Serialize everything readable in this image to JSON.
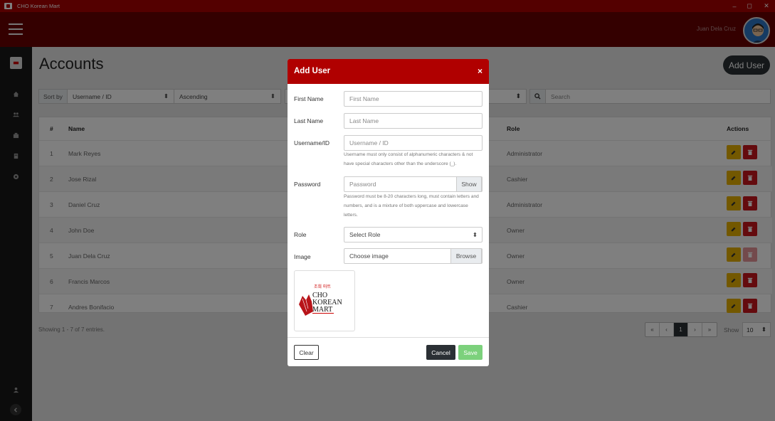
{
  "window": {
    "title": "CHO Korean Mart",
    "minimize": "–",
    "maximize": "◻",
    "close": "✕"
  },
  "topbar": {
    "user_name": "Juan Dela Cruz"
  },
  "page": {
    "title": "Accounts",
    "add_button": "Add User"
  },
  "toolbar": {
    "sort_label": "Sort by",
    "sort_value": "Username / ID",
    "order_value": "Ascending",
    "search_placeholder": "Search"
  },
  "table": {
    "headers": {
      "num": "#",
      "name": "Name",
      "role": "Role",
      "actions": "Actions"
    },
    "rows": [
      {
        "num": "1",
        "name": "Mark Reyes",
        "role": "Administrator"
      },
      {
        "num": "2",
        "name": "Jose Rizal",
        "role": "Cashier"
      },
      {
        "num": "3",
        "name": "Daniel Cruz",
        "role": "Administrator"
      },
      {
        "num": "4",
        "name": "John Doe",
        "role": "Owner"
      },
      {
        "num": "5",
        "name": "Juan Dela Cruz",
        "role": "Owner",
        "delete_disabled": true
      },
      {
        "num": "6",
        "name": "Francis Marcos",
        "role": "Owner"
      },
      {
        "num": "7",
        "name": "Andres Bonifacio",
        "role": "Cashier"
      }
    ]
  },
  "footer": {
    "entries": "Showing 1 - 7 of 7 entries.",
    "pager": [
      "«",
      "‹",
      "1",
      "›",
      "»"
    ],
    "active_page": "1",
    "show_label": "Show",
    "show_value": "10"
  },
  "modal": {
    "title": "Add User",
    "close": "×",
    "first_name": {
      "label": "First Name",
      "placeholder": "First Name"
    },
    "last_name": {
      "label": "Last Name",
      "placeholder": "Last Name"
    },
    "username": {
      "label": "Username/ID",
      "placeholder": "Username / ID",
      "help": "Username must only consist of alphanumeric characters & not have special characters other than the underscore (_)."
    },
    "password": {
      "label": "Password",
      "placeholder": "Password",
      "show": "Show",
      "help": "Password must be 8-20 characters long, must contain letters and numbers, and is a mixture of both uppercase and lowercase letters."
    },
    "role": {
      "label": "Role",
      "value": "Select Role"
    },
    "image": {
      "label": "Image",
      "placeholder": "Choose image",
      "browse": "Browse"
    },
    "logo": {
      "hangul": "조희 마트",
      "line1": "CHO",
      "line2": "KOREAN",
      "line3": "MART"
    },
    "buttons": {
      "clear": "Clear",
      "cancel": "Cancel",
      "save": "Save"
    }
  },
  "colors": {
    "brand": "#b00000",
    "topbar": "#690000",
    "sidebar": "#191919",
    "edit": "#e6b000",
    "delete": "#c8161d",
    "save": "#7cd17c"
  }
}
